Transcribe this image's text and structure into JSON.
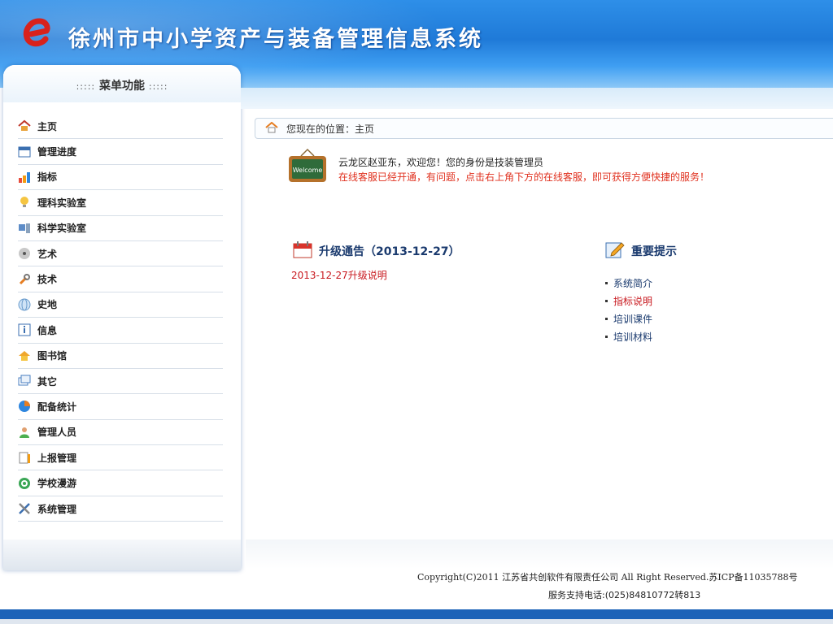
{
  "header": {
    "title": "徐州市中小学资产与装备管理信息系统",
    "brand_color": "#1f7ad8"
  },
  "sidebar": {
    "head_dots_left": ":::::",
    "head_title": "菜单功能",
    "head_dots_right": ":::::",
    "items": [
      {
        "label": "主页",
        "icon": "home-icon"
      },
      {
        "label": "管理进度",
        "icon": "calendar-icon"
      },
      {
        "label": "指标",
        "icon": "bar-chart-icon"
      },
      {
        "label": "理科实验室",
        "icon": "lightbulb-icon"
      },
      {
        "label": "科学实验室",
        "icon": "computer-icon"
      },
      {
        "label": "艺术",
        "icon": "music-disc-icon"
      },
      {
        "label": "技术",
        "icon": "wrench-icon"
      },
      {
        "label": "史地",
        "icon": "globe-icon"
      },
      {
        "label": "信息",
        "icon": "info-icon"
      },
      {
        "label": "图书馆",
        "icon": "library-icon"
      },
      {
        "label": "其它",
        "icon": "window-icon"
      },
      {
        "label": "配备统计",
        "icon": "pie-chart-icon"
      },
      {
        "label": "管理人员",
        "icon": "user-icon"
      },
      {
        "label": "上报管理",
        "icon": "report-icon"
      },
      {
        "label": "学校漫游",
        "icon": "tour-icon"
      },
      {
        "label": "系统管理",
        "icon": "tools-icon"
      }
    ]
  },
  "breadcrumb": {
    "text": "您现在的位置：主页"
  },
  "welcome": {
    "board_text": "Welcome",
    "line1": "云龙区赵亚东，欢迎您！您的身份是技装管理员",
    "line2": "在线客服已经开通，有问题，点击右上角下方的在线客服，即可获得方便快捷的服务！"
  },
  "notice": {
    "title": "升级通告（2013-12-27）",
    "link": "2013-12-27升级说明"
  },
  "tips": {
    "title": "重要提示",
    "items": [
      {
        "label": "系统简介",
        "color": "normal"
      },
      {
        "label": "指标说明",
        "color": "red"
      },
      {
        "label": "培训课件",
        "color": "normal"
      },
      {
        "label": "培训材料",
        "color": "normal"
      }
    ]
  },
  "footer": {
    "copyright": "Copyright(C)2011 江苏省共创软件有限责任公司 All Right Reserved.苏ICP备11035788号",
    "phone": "服务支持电话:(025)84810772转813"
  }
}
